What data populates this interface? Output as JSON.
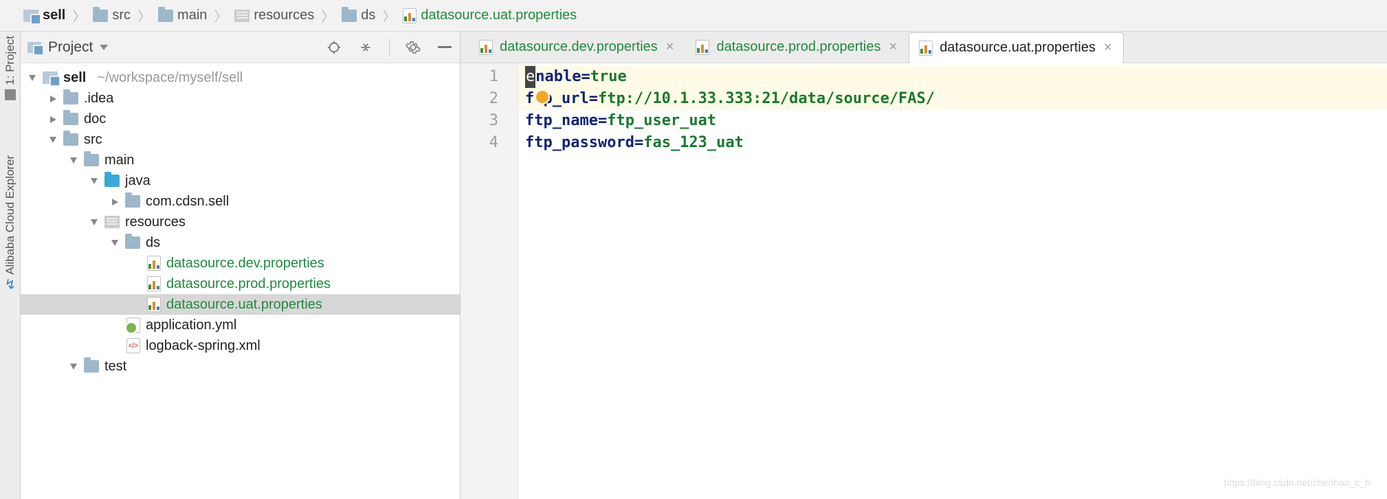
{
  "breadcrumb": [
    {
      "icon": "proj",
      "label": "sell",
      "bold": true
    },
    {
      "icon": "folder",
      "label": "src"
    },
    {
      "icon": "folder",
      "label": "main"
    },
    {
      "icon": "res",
      "label": "resources"
    },
    {
      "icon": "folder",
      "label": "ds"
    },
    {
      "icon": "props",
      "label": "datasource.uat.properties",
      "green": true
    }
  ],
  "left_strip": {
    "project_tab": "1: Project",
    "explorer_tab": "Alibaba Cloud Explorer"
  },
  "project_pane": {
    "title": "Project",
    "root": {
      "label": "sell",
      "hint": "~/workspace/myself/sell"
    },
    "nodes": {
      "idea": ".idea",
      "doc": "doc",
      "src": "src",
      "main": "main",
      "java": "java",
      "pkg": "com.cdsn.sell",
      "resources": "resources",
      "ds": "ds",
      "dev": "datasource.dev.properties",
      "prod": "datasource.prod.properties",
      "uat": "datasource.uat.properties",
      "appyml": "application.yml",
      "logback": "logback-spring.xml",
      "test": "test"
    }
  },
  "tabs": [
    {
      "label": "datasource.dev.properties",
      "active": false
    },
    {
      "label": "datasource.prod.properties",
      "active": false
    },
    {
      "label": "datasource.uat.properties",
      "active": true
    }
  ],
  "editor": {
    "lines": [
      {
        "key_pre": "e",
        "key_rest": "nable",
        "value": "true"
      },
      {
        "key": "ftp_url",
        "value": "ftp://10.1.33.333:21/data/source/FAS/"
      },
      {
        "key": "ftp_name",
        "value": "ftp_user_uat"
      },
      {
        "key": "ftp_password",
        "value": "fas_123_uat"
      }
    ],
    "line_numbers": [
      "1",
      "2",
      "3",
      "4"
    ]
  },
  "watermark": "https://blog.csdn.net/chenhao_c_h"
}
